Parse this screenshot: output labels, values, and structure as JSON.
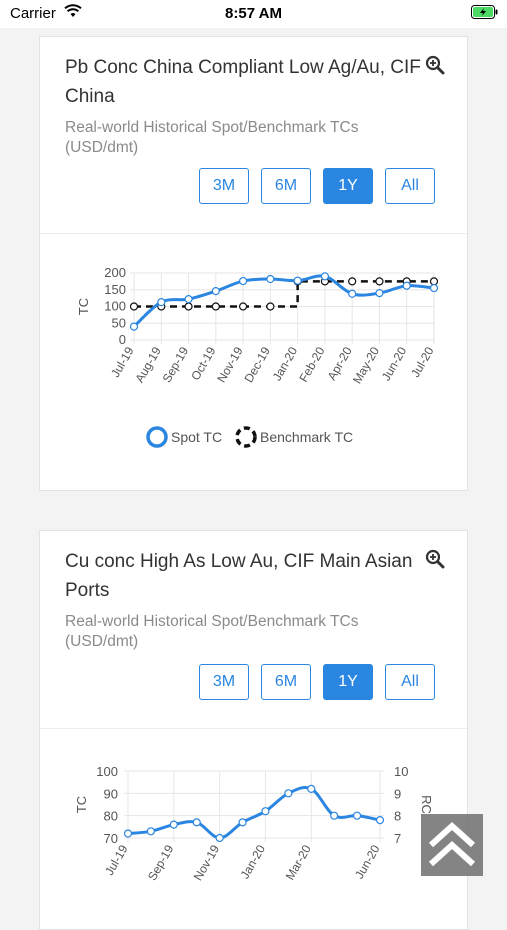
{
  "status_bar": {
    "carrier": "Carrier",
    "time": "8:57 AM"
  },
  "cards": [
    {
      "title": "Pb Conc China Compliant Low Ag/Au, CIF China",
      "subtitle": "Real-world Historical Spot/Benchmark TCs (USD/dmt)",
      "buttons": [
        "3M",
        "6M",
        "1Y",
        "All"
      ],
      "active_button": "1Y",
      "legend": [
        "Spot TC",
        "Benchmark TC"
      ]
    },
    {
      "title": "Cu conc High As Low Au, CIF Main Asian Ports",
      "subtitle": "Real-world Historical Spot/Benchmark TCs (USD/dmt)",
      "buttons": [
        "3M",
        "6M",
        "1Y",
        "All"
      ],
      "active_button": "1Y"
    }
  ],
  "chart_data": [
    {
      "type": "line",
      "ylabel": "TC",
      "ylim": [
        0,
        200
      ],
      "yticks": [
        0,
        50,
        100,
        150,
        200
      ],
      "categories": [
        "Jul-19",
        "Aug-19",
        "Sep-19",
        "Oct-19",
        "Nov-19",
        "Dec-19",
        "Jan-20",
        "Feb-20",
        "Apr-20",
        "May-20",
        "Jun-20",
        "Jul-20"
      ],
      "series": [
        {
          "name": "Spot TC",
          "style": "smooth",
          "color": "#2a86e0",
          "values": [
            40,
            113,
            122,
            146,
            176,
            182,
            177,
            190,
            138,
            140,
            162,
            155
          ]
        },
        {
          "name": "Benchmark TC",
          "style": "step-dashed",
          "color": "#111111",
          "values": [
            100,
            100,
            100,
            100,
            100,
            100,
            175,
            175,
            175,
            175,
            175,
            175
          ]
        }
      ],
      "legend_position": "bottom",
      "grid": true
    },
    {
      "type": "line",
      "ylabel": "TC",
      "y2label": "RC",
      "ylim": [
        70,
        100
      ],
      "yticks": [
        70,
        80,
        90,
        100
      ],
      "y2ticks": [
        7,
        8,
        9,
        10
      ],
      "categories": [
        "Jul-19",
        "Sep-19",
        "Nov-19",
        "Jan-20",
        "Mar-20",
        "Jun-20"
      ],
      "x_points": [
        "Jul-19",
        "Aug-19",
        "Sep-19",
        "Oct-19",
        "Nov-19",
        "Dec-19",
        "Jan-20",
        "Feb-20",
        "Mar-20",
        "Apr-20",
        "May-20",
        "Jun-20"
      ],
      "series": [
        {
          "name": "",
          "style": "smooth",
          "color": "#2a86e0",
          "values": [
            72,
            73,
            76,
            77,
            70,
            77,
            82,
            90,
            92,
            80,
            80,
            78
          ]
        }
      ],
      "grid": true
    }
  ],
  "colors": {
    "accent": "#2a86e0",
    "battery": "#4cd964",
    "scroll_button": "#6e6e6e"
  },
  "icons": {
    "zoom": "zoom-in-icon",
    "scroll_top": "double-chevron-up-icon"
  }
}
